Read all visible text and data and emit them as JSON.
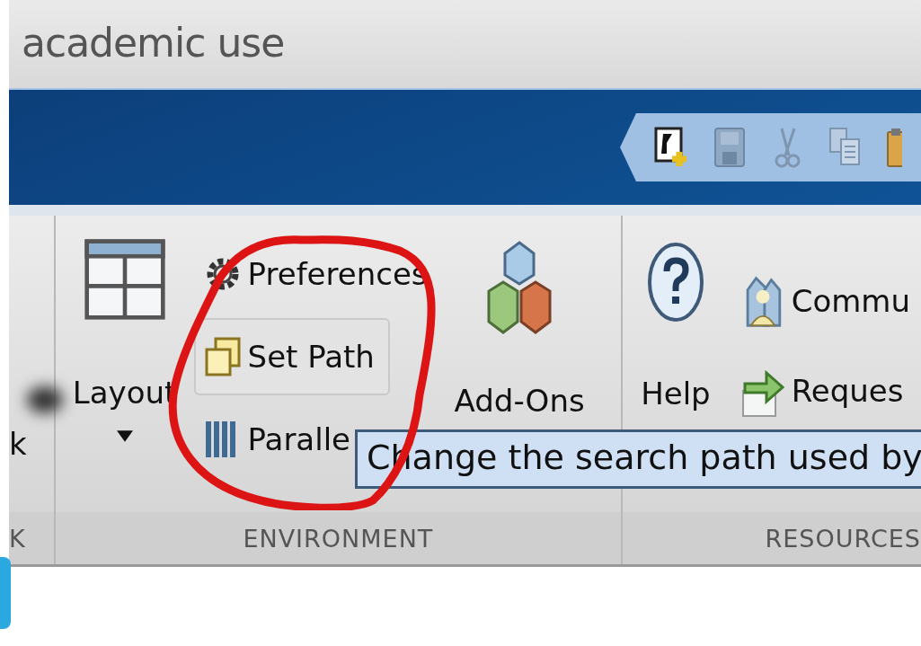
{
  "window": {
    "title": "academic use"
  },
  "left_section": {
    "label": "K",
    "item": "k"
  },
  "environment": {
    "label": "ENVIRONMENT",
    "layout": "Layout",
    "preferences": "Preferences",
    "set_path": {
      "label": "Set Path",
      "hovered": true
    },
    "parallel": "Paralle",
    "add_ons": "Add-Ons"
  },
  "resources": {
    "label": "RESOURCES",
    "help": "Help",
    "community": "Commu",
    "request_support": "Reques"
  },
  "tooltip": "Change the search path used by"
}
